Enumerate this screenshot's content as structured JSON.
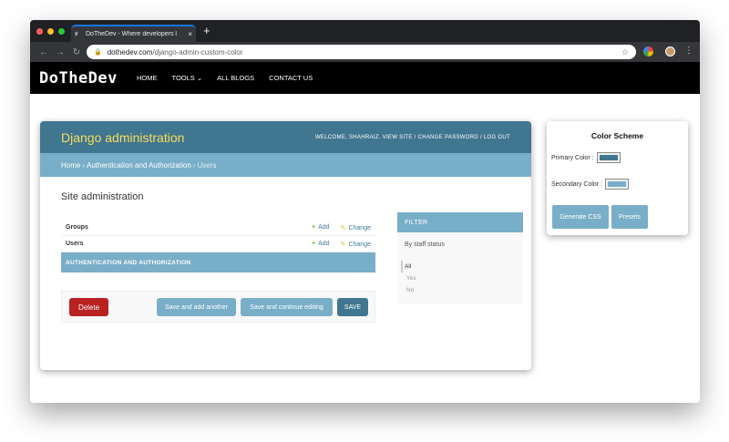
{
  "browser": {
    "tab_title": "DoTheDev - Where developers l",
    "tab_favicon": "DoTheDev favicon",
    "tab_close": "×",
    "new_tab": "+",
    "url_domain": "dothedev.com",
    "url_path": "/django-admin-custom-color",
    "lock_icon": "🔒",
    "back_icon": "←",
    "forward_icon": "→",
    "reload_icon": "↻",
    "star_icon": "☆",
    "menu_icon": "⋮",
    "window_colors": {
      "close": "#ff5f57",
      "minimize": "#febc2e",
      "maximize": "#28c840"
    }
  },
  "site": {
    "logo": "DoTheDev",
    "nav": [
      "HOME",
      "TOOLS ⌄",
      "ALL BLOGS",
      "CONTACT US"
    ]
  },
  "admin": {
    "brand": "Django administration",
    "user_tools": "WELCOME, SHAHRAIZ. VIEW SITE / CHANGE PASSWORD / LOG OUT",
    "breadcrumb": {
      "home": "Home",
      "sep": "›",
      "app": "Authentication and Authorization",
      "current": "Users"
    },
    "page_title": "Site administration",
    "models": [
      {
        "name": "Groups",
        "add": "Add",
        "change": "Change"
      },
      {
        "name": "Users",
        "add": "Add",
        "change": "Change"
      }
    ],
    "caption": "AUTHENTICATION AND AUTHORIZATION",
    "buttons": {
      "delete": "Delete",
      "add_another": "Save and add another",
      "continue": "Save and continue editing",
      "save": "SAVE"
    },
    "filter": {
      "title": "FILTER",
      "by": "By staff status",
      "options": [
        "All",
        "Yes",
        "No"
      ]
    },
    "colors": {
      "primary": "#417690",
      "secondary": "#79aec8",
      "accent": "#f5dd5d",
      "delete": "#ba2121"
    }
  },
  "scheme": {
    "title": "Color Scheme",
    "primary_label": "Primary Color :",
    "primary_value": "#417690",
    "secondary_label": "Secondary Color :",
    "secondary_value": "#79aec8",
    "generate_btn": "Generate CSS",
    "presets_btn": "Presets"
  }
}
